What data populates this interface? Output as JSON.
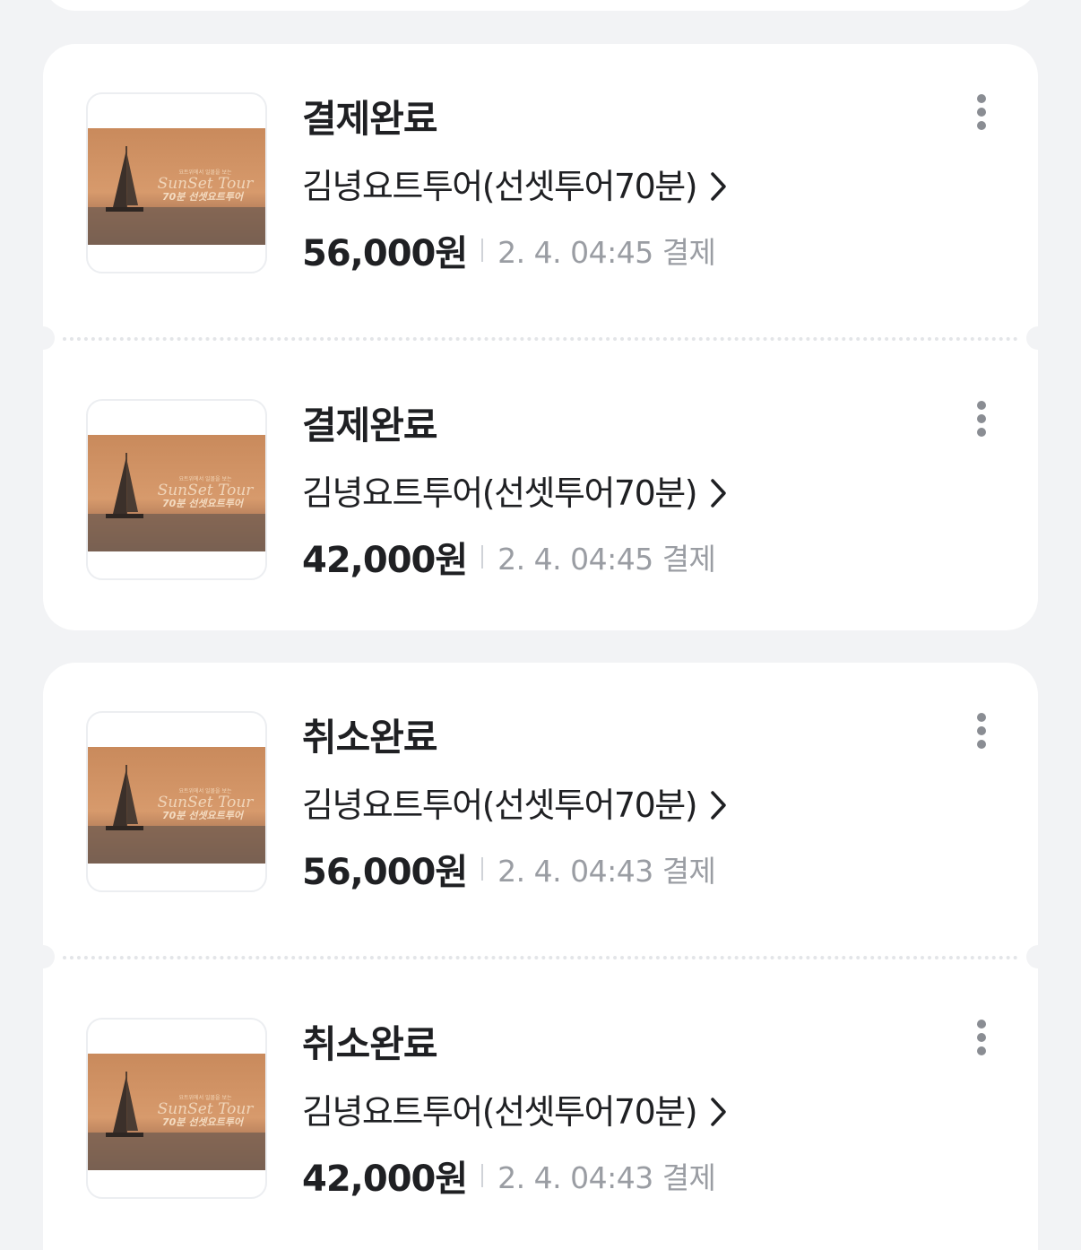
{
  "groups": [
    {
      "orders": [
        {
          "status": "결제완료",
          "product_name": "김녕요트투어(선셋투어70분)",
          "price": "56,000원",
          "paid_at": "2. 4. 04:45 결제",
          "thumbnail": {
            "caption_small": "요트위에서 일몰을 보는",
            "caption_title": "SunSet Tour",
            "caption_sub": "70분 선셋요트투어"
          }
        },
        {
          "status": "결제완료",
          "product_name": "김녕요트투어(선셋투어70분)",
          "price": "42,000원",
          "paid_at": "2. 4. 04:45 결제",
          "thumbnail": {
            "caption_small": "요트위에서 일몰을 보는",
            "caption_title": "SunSet Tour",
            "caption_sub": "70분 선셋요트투어"
          }
        }
      ]
    },
    {
      "orders": [
        {
          "status": "취소완료",
          "product_name": "김녕요트투어(선셋투어70분)",
          "price": "56,000원",
          "paid_at": "2. 4. 04:43 결제",
          "thumbnail": {
            "caption_small": "요트위에서 일몰을 보는",
            "caption_title": "SunSet Tour",
            "caption_sub": "70분 선셋요트투어"
          }
        },
        {
          "status": "취소완료",
          "product_name": "김녕요트투어(선셋투어70분)",
          "price": "42,000원",
          "paid_at": "2. 4. 04:43 결제",
          "thumbnail": {
            "caption_small": "요트위에서 일몰을 보는",
            "caption_title": "SunSet Tour",
            "caption_sub": "70분 선셋요트투어"
          }
        }
      ]
    }
  ],
  "icons": {
    "more": "more-vertical-icon",
    "chevron": "chevron-right-icon"
  },
  "colors": {
    "background": "#f2f3f5",
    "card": "#ffffff",
    "text_primary": "#1f2023",
    "text_secondary": "#9a9da3",
    "icon": "#8a8d93"
  }
}
